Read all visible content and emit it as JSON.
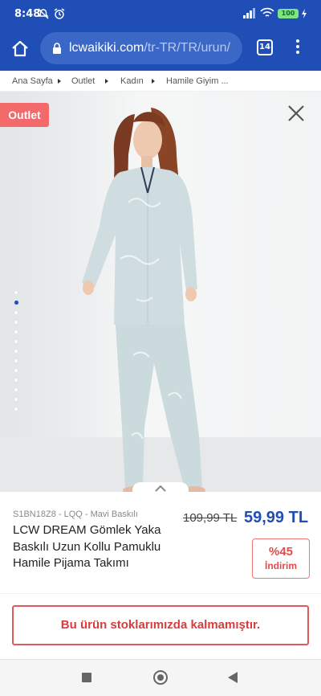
{
  "status_bar": {
    "time": "8:48",
    "battery": "100",
    "icons": [
      "mute-icon",
      "alarm-icon",
      "signal-icon",
      "wifi-icon",
      "battery-icon",
      "charging-icon"
    ]
  },
  "browser": {
    "url_domain": "lcwaikiki.com",
    "url_path": "/tr-TR/TR/urun/",
    "tab_count": "14"
  },
  "breadcrumb": [
    "Ana Sayfa",
    "Outlet",
    "Kadın",
    "Hamile Giyim ..."
  ],
  "gallery": {
    "badge": "Outlet",
    "dot_count": 10,
    "active_dot": 0
  },
  "product": {
    "sku": "S1BN18Z8 - LQQ - Mavi Baskılı",
    "name": "LCW DREAM Gömlek Yaka Baskılı Uzun Kollu Pamuklu Hamile Pijama Takımı",
    "old_price": "109,99 TL",
    "new_price": "59,99 TL",
    "discount_percent": "%45",
    "discount_label": "İndirim"
  },
  "stock": {
    "message": "Bu ürün stoklarımızda kalmamıştır."
  },
  "colors": {
    "brand_blue": "#1f4fb6",
    "outlet_red": "#f26a6a",
    "alert_red": "#d83c3c"
  }
}
